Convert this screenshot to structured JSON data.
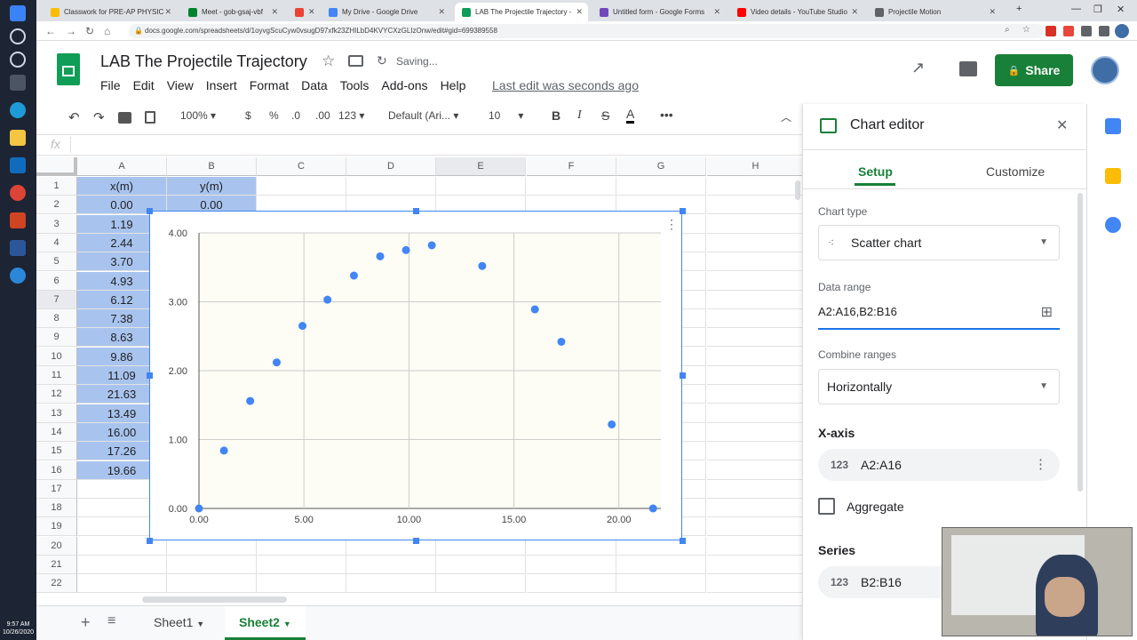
{
  "browser": {
    "tabs": [
      {
        "title": "Classwork for PRE-AP PHYSICS",
        "color": "#fbbc04"
      },
      {
        "title": "Meet - gob-gsaj-vbf",
        "color": "#00832d"
      },
      {
        "title": "",
        "color": "#ea4335"
      },
      {
        "title": "My Drive - Google Drive",
        "color": "#4285f4"
      },
      {
        "title": "LAB The Projectile Trajectory -",
        "color": "#0f9d58",
        "active": true
      },
      {
        "title": "Untitled form - Google Forms",
        "color": "#7248b9"
      },
      {
        "title": "Video details - YouTube Studio",
        "color": "#ff0000"
      },
      {
        "title": "Projectile Motion",
        "color": "#5f6368"
      }
    ],
    "url": "docs.google.com/spreadsheets/d/1oyvgScuCyw0vsugD97xfk23ZHILbD4KVYCXzGLIzOnw/edit#gid=699389558"
  },
  "taskbar": {
    "time": "9:57 AM",
    "date": "10/26/2020"
  },
  "header": {
    "title": "LAB The Projectile Trajectory",
    "status": "Saving...",
    "menu": [
      "File",
      "Edit",
      "View",
      "Insert",
      "Format",
      "Data",
      "Tools",
      "Add-ons",
      "Help"
    ],
    "last_edit": "Last edit was seconds ago",
    "share_label": "Share"
  },
  "toolbar": {
    "zoom": "100%",
    "currency": "$",
    "percent": "%",
    "dec_decrease": ".0",
    "dec_increase": ".00",
    "more_formats": "123",
    "font": "Default (Ari...",
    "font_size": "10",
    "bold": "B",
    "italic": "I",
    "strike": "S",
    "text_color": "A",
    "fx": "fx"
  },
  "grid": {
    "columns": [
      "A",
      "B",
      "C",
      "D",
      "E",
      "F",
      "G",
      "H"
    ],
    "rows": [
      "1",
      "2",
      "3",
      "4",
      "5",
      "6",
      "7",
      "8",
      "9",
      "10",
      "11",
      "12",
      "13",
      "14",
      "15",
      "16",
      "17",
      "18",
      "19",
      "20",
      "21",
      "22"
    ],
    "colA": [
      "x(m)",
      "0.00",
      "1.19",
      "2.44",
      "3.70",
      "4.93",
      "6.12",
      "7.38",
      "8.63",
      "9.86",
      "11.09",
      "21.63",
      "13.49",
      "16.00",
      "17.26",
      "19.66"
    ],
    "colB": [
      "y(m)",
      "0.00"
    ]
  },
  "sheet_tabs": {
    "add": "+",
    "list": "≡",
    "tabs": [
      "Sheet1",
      "Sheet2"
    ],
    "active": "Sheet2"
  },
  "chart_data": {
    "type": "scatter",
    "title": "",
    "xlabel": "",
    "ylabel": "",
    "xlim": [
      0,
      22
    ],
    "ylim": [
      0,
      4
    ],
    "xticks": [
      "0.00",
      "5.00",
      "10.00",
      "15.00",
      "20.00"
    ],
    "yticks": [
      "0.00",
      "1.00",
      "2.00",
      "3.00",
      "4.00"
    ],
    "grid": true,
    "points": [
      {
        "x": 0.0,
        "y": 0.0
      },
      {
        "x": 1.19,
        "y": 0.84
      },
      {
        "x": 2.44,
        "y": 1.56
      },
      {
        "x": 3.7,
        "y": 2.12
      },
      {
        "x": 4.93,
        "y": 2.65
      },
      {
        "x": 6.12,
        "y": 3.03
      },
      {
        "x": 7.38,
        "y": 3.38
      },
      {
        "x": 8.63,
        "y": 3.66
      },
      {
        "x": 9.86,
        "y": 3.75
      },
      {
        "x": 11.09,
        "y": 3.82
      },
      {
        "x": 13.49,
        "y": 3.52
      },
      {
        "x": 16.0,
        "y": 2.89
      },
      {
        "x": 17.26,
        "y": 2.42
      },
      {
        "x": 19.66,
        "y": 1.22
      },
      {
        "x": 21.63,
        "y": 0.0
      }
    ],
    "color": "#4285f4"
  },
  "editor": {
    "title": "Chart editor",
    "tabs": [
      "Setup",
      "Customize"
    ],
    "active_tab": "Setup",
    "chart_type_label": "Chart type",
    "chart_type": "Scatter chart",
    "data_range_label": "Data range",
    "data_range": "A2:A16,B2:B16",
    "combine_label": "Combine ranges",
    "combine_value": "Horizontally",
    "xaxis_label": "X-axis",
    "xaxis_range": "A2:A16",
    "chip_icon": "123",
    "aggregate_label": "Aggregate",
    "series_label": "Series",
    "series_range": "B2:B16"
  },
  "colors": {
    "accent": "#188038",
    "selection": "#a8c4ee",
    "chart_border": "#4285f4"
  }
}
